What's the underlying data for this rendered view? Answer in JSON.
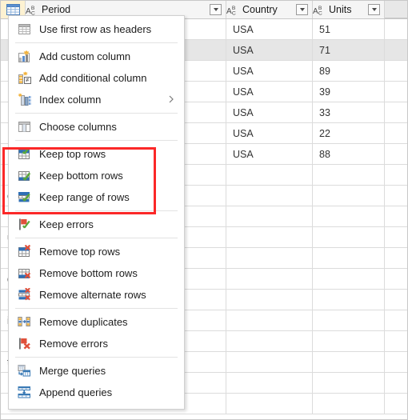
{
  "app": {
    "name": "power-query-editor",
    "accent_red": "#fb2828",
    "header_bg": "#f5f5f5",
    "corner_bg": "#fdf2d2",
    "selected_row_bg": "#e6e6e6"
  },
  "grid": {
    "corner": {
      "icon": "table-icon",
      "tooltip": ""
    },
    "columns": [
      {
        "key": "period",
        "type_label": "ABC",
        "title": "Period",
        "filter_icon": "chevron-down-icon"
      },
      {
        "key": "country",
        "type_label": "ABC",
        "title": "Country",
        "filter_icon": "chevron-down-icon"
      },
      {
        "key": "units",
        "type_label": "ABC",
        "title": "Units",
        "filter_icon": "chevron-down-icon"
      }
    ],
    "rows": [
      {
        "period": "",
        "country": "USA",
        "units": "51",
        "selected": false
      },
      {
        "period": "",
        "country": "USA",
        "units": "71",
        "selected": true
      },
      {
        "period": "",
        "country": "USA",
        "units": "89",
        "selected": false
      },
      {
        "period": "",
        "country": "USA",
        "units": "39",
        "selected": false
      },
      {
        "period": "",
        "country": "USA",
        "units": "33",
        "selected": false
      },
      {
        "period": "",
        "country": "USA",
        "units": "22",
        "selected": false
      },
      {
        "period": "",
        "country": "USA",
        "units": "88",
        "selected": false
      },
      {
        "period": "",
        "country": "",
        "units": "",
        "selected": false
      },
      {
        "period": "onsect…",
        "country": "",
        "units": "",
        "selected": false
      },
      {
        "period": "",
        "country": "",
        "units": "",
        "selected": false
      },
      {
        "period": "us risu…",
        "country": "",
        "units": "",
        "selected": false
      },
      {
        "period": "",
        "country": "",
        "units": "",
        "selected": false
      },
      {
        "period": "din te…",
        "country": "",
        "units": "",
        "selected": false
      },
      {
        "period": "",
        "country": "",
        "units": "",
        "selected": false
      },
      {
        "period": "ismo…",
        "country": "",
        "units": "",
        "selected": false
      },
      {
        "period": "",
        "country": "",
        "units": "",
        "selected": false
      },
      {
        "period": "t eget…",
        "country": "",
        "units": "",
        "selected": false
      },
      {
        "period": "",
        "country": "",
        "units": "",
        "selected": false
      },
      {
        "period": "",
        "country": "",
        "units": "",
        "selected": false
      }
    ]
  },
  "menu": {
    "items": [
      {
        "id": "use-first-row-as-headers",
        "label": "Use first row as headers",
        "icon": "table-header-icon",
        "submenu": false,
        "sep_after": true,
        "highlighted": false
      },
      {
        "id": "add-custom-column",
        "label": "Add custom column",
        "icon": "add-custom-column-icon",
        "submenu": false,
        "sep_after": false,
        "highlighted": false
      },
      {
        "id": "add-conditional-column",
        "label": "Add conditional column",
        "icon": "conditional-column-icon",
        "submenu": false,
        "sep_after": false,
        "highlighted": false
      },
      {
        "id": "index-column",
        "label": "Index column",
        "icon": "index-column-icon",
        "submenu": true,
        "sep_after": true,
        "highlighted": false
      },
      {
        "id": "choose-columns",
        "label": "Choose columns",
        "icon": "choose-columns-icon",
        "submenu": false,
        "sep_after": true,
        "highlighted": false
      },
      {
        "id": "keep-top-rows",
        "label": "Keep top rows",
        "icon": "keep-top-rows-icon",
        "submenu": false,
        "sep_after": false,
        "highlighted": true
      },
      {
        "id": "keep-bottom-rows",
        "label": "Keep bottom rows",
        "icon": "keep-bottom-rows-icon",
        "submenu": false,
        "sep_after": false,
        "highlighted": true
      },
      {
        "id": "keep-range-of-rows",
        "label": "Keep range of rows",
        "icon": "keep-range-rows-icon",
        "submenu": false,
        "sep_after": true,
        "highlighted": true
      },
      {
        "id": "keep-errors",
        "label": "Keep errors",
        "icon": "keep-errors-icon",
        "submenu": false,
        "sep_after": true,
        "highlighted": false
      },
      {
        "id": "remove-top-rows",
        "label": "Remove top rows",
        "icon": "remove-top-rows-icon",
        "submenu": false,
        "sep_after": false,
        "highlighted": false
      },
      {
        "id": "remove-bottom-rows",
        "label": "Remove bottom rows",
        "icon": "remove-bottom-rows-icon",
        "submenu": false,
        "sep_after": false,
        "highlighted": false
      },
      {
        "id": "remove-alternate-rows",
        "label": "Remove alternate rows",
        "icon": "remove-alternate-icon",
        "submenu": false,
        "sep_after": true,
        "highlighted": false
      },
      {
        "id": "remove-duplicates",
        "label": "Remove duplicates",
        "icon": "remove-duplicates-icon",
        "submenu": false,
        "sep_after": false,
        "highlighted": false
      },
      {
        "id": "remove-errors",
        "label": "Remove errors",
        "icon": "remove-errors-icon",
        "submenu": false,
        "sep_after": true,
        "highlighted": false
      },
      {
        "id": "merge-queries",
        "label": "Merge queries",
        "icon": "merge-queries-icon",
        "submenu": false,
        "sep_after": false,
        "highlighted": false
      },
      {
        "id": "append-queries",
        "label": "Append queries",
        "icon": "append-queries-icon",
        "submenu": false,
        "sep_after": false,
        "highlighted": false
      }
    ],
    "highlight_box": {
      "name": "keep-rows-highlight",
      "color": "#fb2828"
    }
  }
}
